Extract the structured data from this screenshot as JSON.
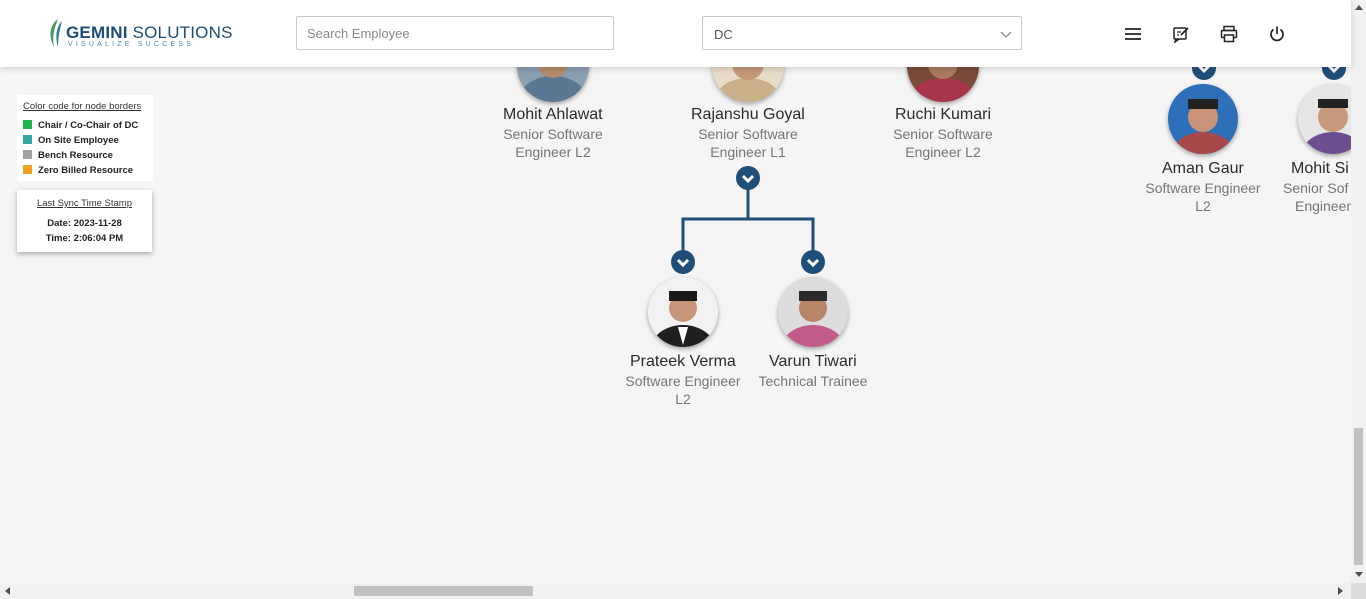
{
  "header": {
    "logo_title_bold": "GEMINI",
    "logo_title_rest": " SOLUTIONS",
    "logo_tagline": "VISUALIZE SUCCESS",
    "search_placeholder": "Search Employee",
    "search_value": "",
    "dropdown_value": "DC",
    "icons": [
      "menu-icon",
      "feedback-edit-icon",
      "print-icon",
      "power-icon"
    ]
  },
  "legend": {
    "title": "Color code for node borders",
    "items": [
      {
        "label": "Chair / Co-Chair of DC",
        "color": "#22b14c"
      },
      {
        "label": "On Site Employee",
        "color": "#3aa6a0"
      },
      {
        "label": "Bench Resource",
        "color": "#a0a0a0"
      },
      {
        "label": "Zero Billed Resource",
        "color": "#f0a020"
      }
    ]
  },
  "sync": {
    "title": "Last Sync Time Stamp",
    "date": "Date: 2023-11-28",
    "time": "Time: 2:06:04 PM"
  },
  "tree": {
    "row1": [
      {
        "name": "Mohit Ahlawat",
        "role_line1": "Senior Software",
        "role_line2": "Engineer L2"
      },
      {
        "name": "Rajanshu Goyal",
        "role_line1": "Senior Software",
        "role_line2": "Engineer L1"
      },
      {
        "name": "Ruchi Kumari",
        "role_line1": "Senior Software",
        "role_line2": "Engineer L2"
      },
      {
        "name": "Aman Gaur",
        "role_line1": "Software Engineer",
        "role_line2": "L2"
      },
      {
        "name": "Mohit Si",
        "role_line1": "Senior Sof",
        "role_line2": "Engineer"
      }
    ],
    "row2": [
      {
        "name": "Prateek Verma",
        "role_line1": "Software Engineer",
        "role_line2": "L2"
      },
      {
        "name": "Varun Tiwari",
        "role_line1": "Technical Trainee",
        "role_line2": ""
      }
    ]
  },
  "colors": {
    "node_toggle": "#1f4e79",
    "connector": "#1f4e79",
    "brand": "#1f4d74"
  }
}
